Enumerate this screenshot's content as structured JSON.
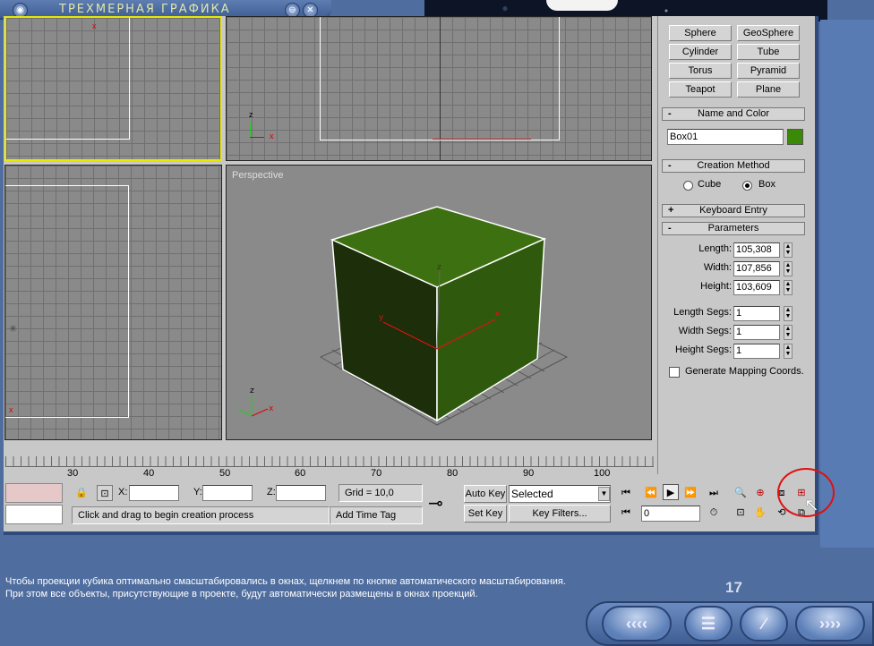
{
  "window": {
    "title": "ТРЕХМЕРНАЯ ГРАФИКА"
  },
  "viewports": {
    "perspective_label": "Perspective"
  },
  "object_type": {
    "buttons": [
      [
        "Sphere",
        "GeoSphere"
      ],
      [
        "Cylinder",
        "Tube"
      ],
      [
        "Torus",
        "Pyramid"
      ],
      [
        "Teapot",
        "Plane"
      ]
    ]
  },
  "name_color": {
    "header": "Name and Color",
    "sign": "-",
    "name_value": "Box01",
    "color": "#3a8a08"
  },
  "creation_method": {
    "header": "Creation Method",
    "sign": "-",
    "cube_label": "Cube",
    "box_label": "Box",
    "selected": "Box"
  },
  "keyboard_entry": {
    "header": "Keyboard Entry",
    "sign": "+"
  },
  "parameters": {
    "header": "Parameters",
    "sign": "-",
    "length_label": "Length:",
    "length_value": "105,308",
    "width_label": "Width:",
    "width_value": "107,856",
    "height_label": "Height:",
    "height_value": "103,609",
    "length_segs_label": "Length Segs:",
    "length_segs_value": "1",
    "width_segs_label": "Width Segs:",
    "width_segs_value": "1",
    "height_segs_label": "Height Segs:",
    "height_segs_value": "1",
    "gen_mapping_label": "Generate Mapping Coords."
  },
  "timeline": {
    "ticks": [
      "30",
      "40",
      "50",
      "60",
      "70",
      "80",
      "90",
      "100"
    ]
  },
  "status": {
    "x_label": "X:",
    "y_label": "Y:",
    "z_label": "Z:",
    "grid": "Grid = 10,0",
    "auto_key": "Auto Key",
    "set_key": "Set Key",
    "selected_value": "Selected",
    "key_filters": "Key Filters...",
    "frame_value": "0",
    "prompt": "Click and drag to begin creation process",
    "add_time_tag": "Add Time Tag"
  },
  "caption": "Чтобы проекции кубика оптимально смасштабировались в окнах, щелкнем по кнопке автоматического масштабирования. При этом все объекты, присутствующие в проекте, будут автоматически размещены в окнах проекций.",
  "page_number": "17",
  "colors": {
    "box_light": "#3d7010",
    "box_dark": "#1c2e0a",
    "highlight": "#e01010",
    "active_viewport": "#e8e800"
  },
  "icons": [
    "minimize-icon",
    "close-icon",
    "lock-icon",
    "key-icon",
    "play-icon",
    "zoom-extents-all-icon",
    "pan-icon"
  ]
}
